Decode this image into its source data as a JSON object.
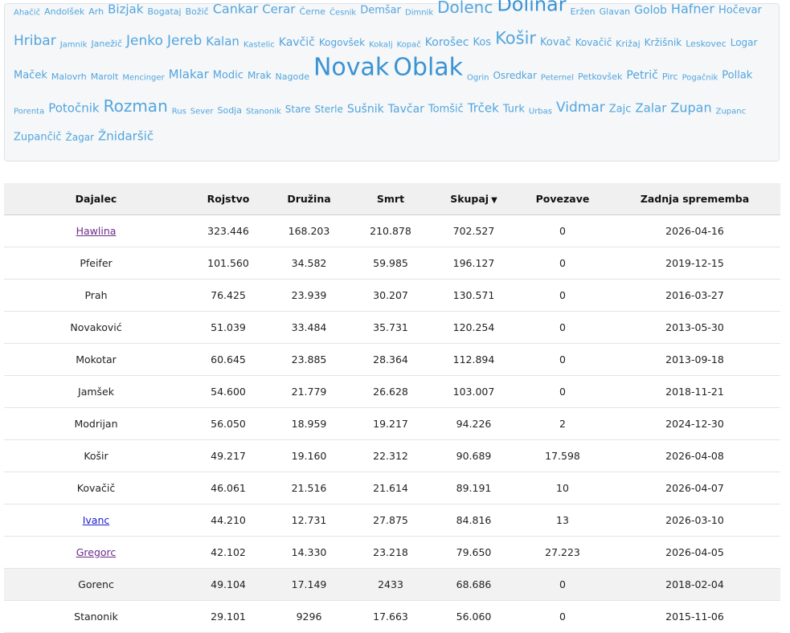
{
  "cloud": {
    "lines": [
      [
        {
          "t": "Ahačič",
          "s": 10
        },
        {
          "t": "Andolšek",
          "s": 11
        },
        {
          "t": "Arh",
          "s": 11
        },
        {
          "t": "Bizjak",
          "s": 15
        },
        {
          "t": "Bogataj",
          "s": 11
        },
        {
          "t": "Božič",
          "s": 11
        },
        {
          "t": "Cankar",
          "s": 16
        },
        {
          "t": "Cerar",
          "s": 15
        },
        {
          "t": "Černe",
          "s": 11
        },
        {
          "t": "Česnik",
          "s": 10
        },
        {
          "t": "Demšar",
          "s": 13
        },
        {
          "t": "Dimnik",
          "s": 10
        },
        {
          "t": "Dolenc",
          "s": 20
        },
        {
          "t": "Dolinar",
          "s": 24
        },
        {
          "t": "Eržen",
          "s": 11
        },
        {
          "t": "Glavan",
          "s": 11
        },
        {
          "t": "Golob",
          "s": 14
        },
        {
          "t": "Hafner",
          "s": 16
        },
        {
          "t": "Hočevar",
          "s": 13
        }
      ],
      [
        {
          "t": "Hribar",
          "s": 17
        },
        {
          "t": "Jamnik",
          "s": 10
        },
        {
          "t": "Janežič",
          "s": 11
        },
        {
          "t": "Jenko",
          "s": 17
        },
        {
          "t": "Jereb",
          "s": 17
        },
        {
          "t": "Kalan",
          "s": 15
        },
        {
          "t": "Kastelic",
          "s": 10
        },
        {
          "t": "Kavčič",
          "s": 14
        },
        {
          "t": "Kogovšek",
          "s": 12
        },
        {
          "t": "Kokalj",
          "s": 10
        },
        {
          "t": "Kopač",
          "s": 10
        },
        {
          "t": "Korošec",
          "s": 14
        },
        {
          "t": "Kos",
          "s": 13
        },
        {
          "t": "Košir",
          "s": 21
        },
        {
          "t": "Kovač",
          "s": 13
        },
        {
          "t": "Kovačič",
          "s": 12
        },
        {
          "t": "Križaj",
          "s": 11
        },
        {
          "t": "Kržišnik",
          "s": 12
        },
        {
          "t": "Leskovec",
          "s": 11
        },
        {
          "t": "Logar",
          "s": 12
        }
      ],
      [
        {
          "t": "Maček",
          "s": 13
        },
        {
          "t": "Malovrh",
          "s": 11
        },
        {
          "t": "Marolt",
          "s": 11
        },
        {
          "t": "Mencinger",
          "s": 10
        },
        {
          "t": "Mlakar",
          "s": 15
        },
        {
          "t": "Modic",
          "s": 13
        },
        {
          "t": "Mrak",
          "s": 12
        },
        {
          "t": "Nagode",
          "s": 11
        },
        {
          "t": "Novak",
          "s": 30
        },
        {
          "t": "Oblak",
          "s": 30
        },
        {
          "t": "Ogrin",
          "s": 10
        },
        {
          "t": "Osredkar",
          "s": 12
        },
        {
          "t": "Peternel",
          "s": 10
        },
        {
          "t": "Petkovšek",
          "s": 11
        },
        {
          "t": "Petrič",
          "s": 14
        },
        {
          "t": "Pirc",
          "s": 11
        },
        {
          "t": "Pogačnik",
          "s": 10
        },
        {
          "t": "Pollak",
          "s": 13
        }
      ],
      [
        {
          "t": "Porenta",
          "s": 10
        },
        {
          "t": "Potočnik",
          "s": 15
        },
        {
          "t": "Rozman",
          "s": 20
        },
        {
          "t": "Rus",
          "s": 10
        },
        {
          "t": "Sever",
          "s": 10
        },
        {
          "t": "Sodja",
          "s": 11
        },
        {
          "t": "Stanonik",
          "s": 10
        },
        {
          "t": "Stare",
          "s": 12
        },
        {
          "t": "Sterle",
          "s": 12
        },
        {
          "t": "Sušnik",
          "s": 14
        },
        {
          "t": "Tavčar",
          "s": 14
        },
        {
          "t": "Tomšič",
          "s": 13
        },
        {
          "t": "Trček",
          "s": 15
        },
        {
          "t": "Turk",
          "s": 13
        },
        {
          "t": "Urbas",
          "s": 10
        },
        {
          "t": "Vidmar",
          "s": 17
        },
        {
          "t": "Zajc",
          "s": 13
        },
        {
          "t": "Zalar",
          "s": 15
        },
        {
          "t": "Zupan",
          "s": 16
        },
        {
          "t": "Zupanc",
          "s": 10
        }
      ],
      [
        {
          "t": "Zupančič",
          "s": 13
        },
        {
          "t": "Žagar",
          "s": 12
        },
        {
          "t": "Žnidaršič",
          "s": 15
        }
      ]
    ]
  },
  "table": {
    "headers": {
      "dajalec": "Dajalec",
      "rojstvo": "Rojstvo",
      "druzina": "Družina",
      "smrt": "Smrt",
      "skupaj": "Skupaj",
      "sort_arrow": "▼",
      "povezave": "Povezave",
      "zadnja": "Zadnja sprememba"
    },
    "rows": [
      {
        "name": "Hawlina",
        "link": "visited",
        "r": "323.446",
        "d": "168.203",
        "s": "210.878",
        "sk": "702.527",
        "p": "0",
        "z": "2026-04-16"
      },
      {
        "name": "Pfeifer",
        "link": "",
        "r": "101.560",
        "d": "34.582",
        "s": "59.985",
        "sk": "196.127",
        "p": "0",
        "z": "2019-12-15"
      },
      {
        "name": "Prah",
        "link": "",
        "r": "76.425",
        "d": "23.939",
        "s": "30.207",
        "sk": "130.571",
        "p": "0",
        "z": "2016-03-27"
      },
      {
        "name": "Novaković",
        "link": "",
        "r": "51.039",
        "d": "33.484",
        "s": "35.731",
        "sk": "120.254",
        "p": "0",
        "z": "2013-05-30"
      },
      {
        "name": "Mokotar",
        "link": "",
        "r": "60.645",
        "d": "23.885",
        "s": "28.364",
        "sk": "112.894",
        "p": "0",
        "z": "2013-09-18"
      },
      {
        "name": "Jamšek",
        "link": "",
        "r": "54.600",
        "d": "21.779",
        "s": "26.628",
        "sk": "103.007",
        "p": "0",
        "z": "2018-11-21"
      },
      {
        "name": "Modrijan",
        "link": "",
        "r": "56.050",
        "d": "18.959",
        "s": "19.217",
        "sk": "94.226",
        "p": "2",
        "z": "2024-12-30"
      },
      {
        "name": "Košir",
        "link": "",
        "r": "49.217",
        "d": "19.160",
        "s": "22.312",
        "sk": "90.689",
        "p": "17.598",
        "z": "2026-04-08"
      },
      {
        "name": "Kovačič",
        "link": "",
        "r": "46.061",
        "d": "21.516",
        "s": "21.614",
        "sk": "89.191",
        "p": "10",
        "z": "2026-04-07"
      },
      {
        "name": "Ivanc",
        "link": "unvisited",
        "r": "44.210",
        "d": "12.731",
        "s": "27.875",
        "sk": "84.816",
        "p": "13",
        "z": "2026-03-10"
      },
      {
        "name": "Gregorc",
        "link": "visited",
        "r": "42.102",
        "d": "14.330",
        "s": "23.218",
        "sk": "79.650",
        "p": "27.223",
        "z": "2026-04-05"
      },
      {
        "name": "Gorenc",
        "link": "",
        "r": "49.104",
        "d": "17.149",
        "s": "2433",
        "sk": "68.686",
        "p": "0",
        "z": "2018-02-04",
        "hl": true
      },
      {
        "name": "Stanonik",
        "link": "",
        "r": "29.101",
        "d": "9296",
        "s": "17.663",
        "sk": "56.060",
        "p": "0",
        "z": "2015-11-06"
      }
    ]
  },
  "colors": {
    "cloud_word": "#53a5dd",
    "cloud_word_big": "#3a93d3",
    "link_visited": "#6b2b8a",
    "link_unvisited": "#1a1acc"
  }
}
